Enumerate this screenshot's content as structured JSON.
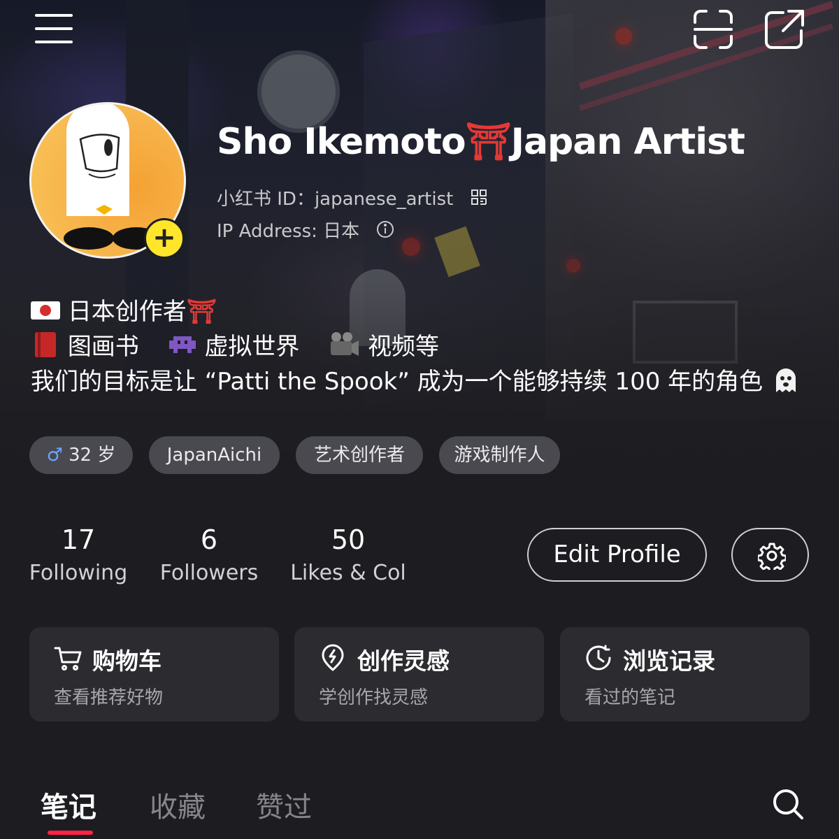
{
  "profile": {
    "name": "Sho Ikemoto",
    "name_suffix": "Japan Artist",
    "torii": "⛩",
    "id_label": "小红书 ID：japanese_artist",
    "ip_label": "IP Address: 日本"
  },
  "bio": {
    "line1": "日本创作者",
    "line2_a": "图画书",
    "line2_b": "虚拟世界",
    "line2_c": "视频等",
    "line3": "我们的目标是让 “Patti the Spook” 成为一个能够持续 100 年的角色"
  },
  "tags": [
    {
      "label": "32 岁",
      "icon": "male-icon"
    },
    {
      "label": "JapanAichi"
    },
    {
      "label": "艺术创作者"
    },
    {
      "label": "游戏制作人"
    }
  ],
  "stats": [
    {
      "value": "17",
      "label": "Following"
    },
    {
      "value": "6",
      "label": "Followers"
    },
    {
      "value": "50",
      "label": "Likes & Col"
    }
  ],
  "buttons": {
    "edit_profile": "Edit Profile"
  },
  "cards": [
    {
      "title": "购物车",
      "subtitle": "查看推荐好物",
      "icon": "cart-icon"
    },
    {
      "title": "创作灵感",
      "subtitle": "学创作找灵感",
      "icon": "lightbulb-icon"
    },
    {
      "title": "浏览记录",
      "subtitle": "看过的笔记",
      "icon": "clock-icon"
    }
  ],
  "tabs": [
    {
      "label": "笔记",
      "active": true
    },
    {
      "label": "收藏",
      "active": false
    },
    {
      "label": "赞过",
      "active": false
    }
  ],
  "colors": {
    "accent": "#ff2442",
    "badge": "#ffe62b",
    "torii": "#e53935",
    "background": "#1d1d21",
    "card": "#2c2c30"
  }
}
